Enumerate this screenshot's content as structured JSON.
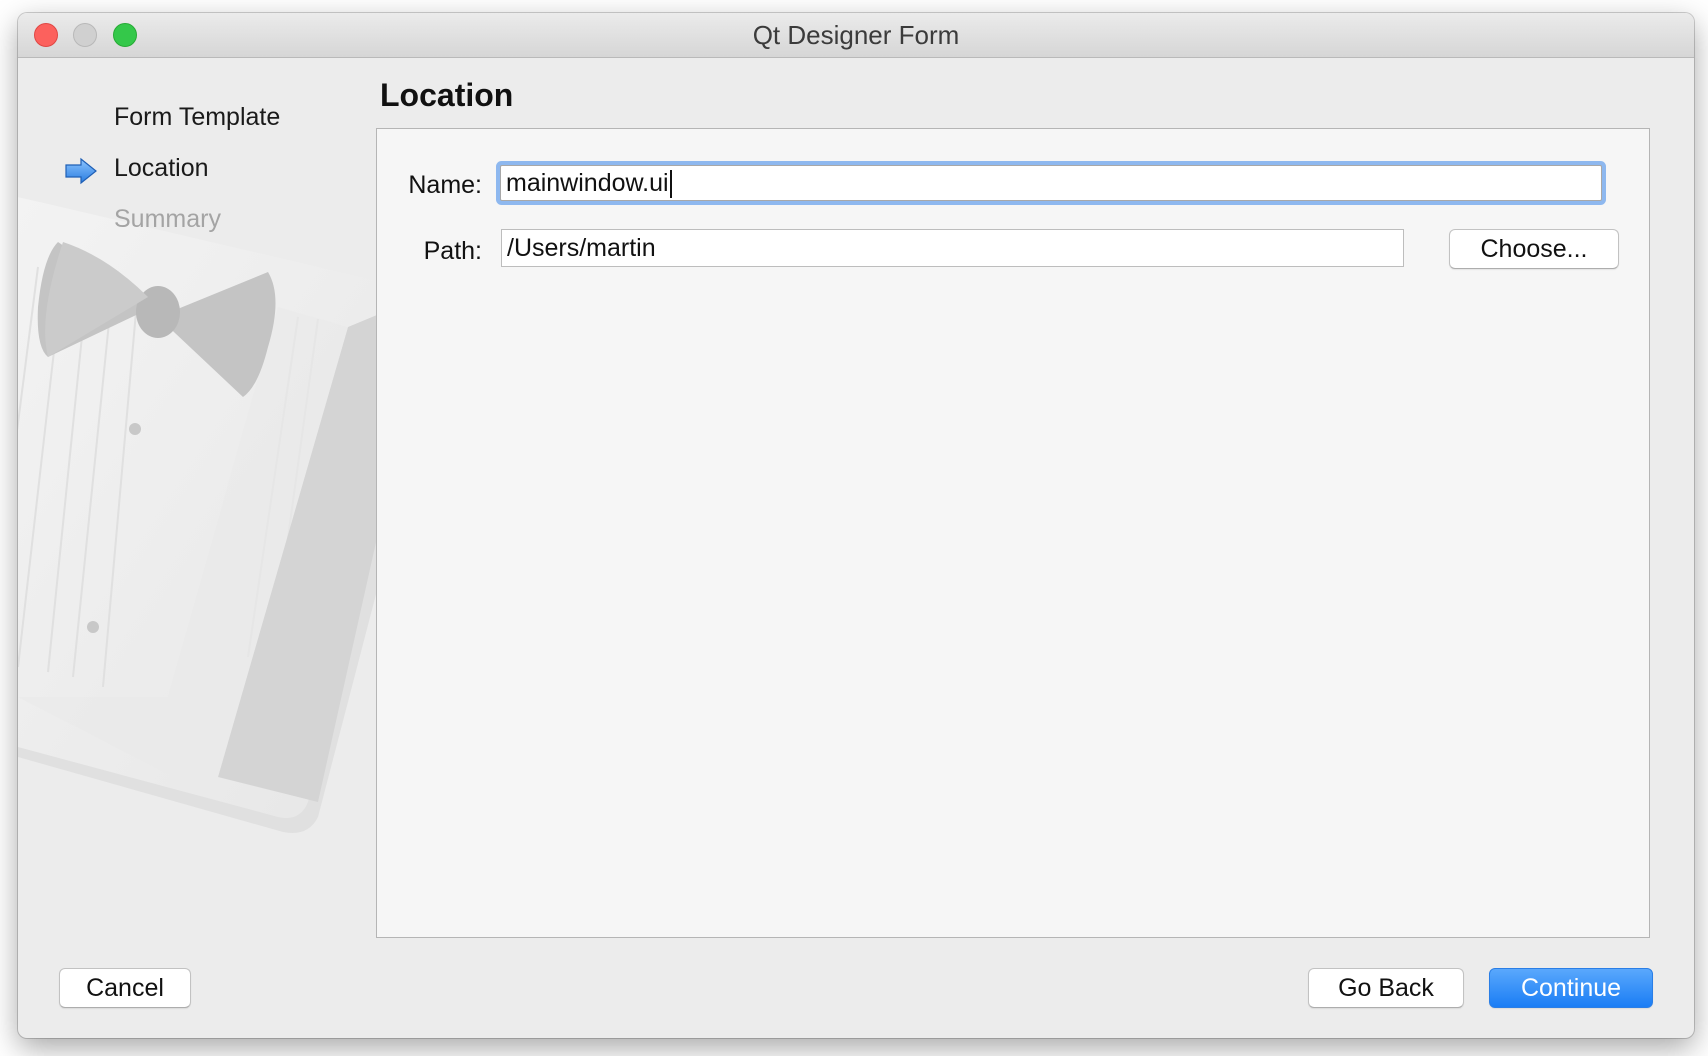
{
  "window": {
    "title": "Qt Designer Form"
  },
  "wizard": {
    "steps": [
      {
        "label": "Form Template",
        "state": "done"
      },
      {
        "label": "Location",
        "state": "current"
      },
      {
        "label": "Summary",
        "state": "pending"
      }
    ],
    "current_step_icon": "right-arrow-icon"
  },
  "page": {
    "title": "Location",
    "name_label": "Name:",
    "name_value": "mainwindow.ui",
    "path_label": "Path:",
    "path_value": "/Users/martin",
    "choose_label": "Choose..."
  },
  "footer": {
    "cancel_label": "Cancel",
    "go_back_label": "Go Back",
    "continue_label": "Continue"
  },
  "colors": {
    "accent": "#1a7df5",
    "focus_ring": "#8eb8ef",
    "close": "#fc615d",
    "zoom": "#34c84a"
  }
}
